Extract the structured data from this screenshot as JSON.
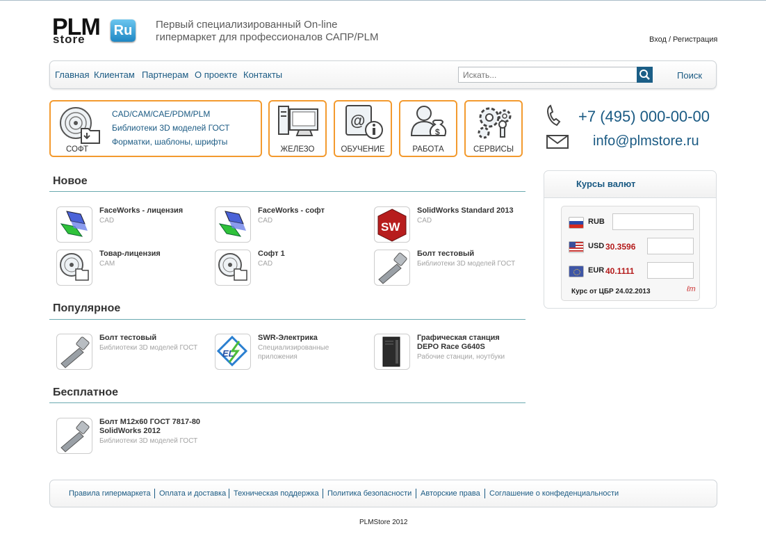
{
  "header": {
    "logo_plm": "PLM",
    "logo_store": "store",
    "logo_ru": "Ru",
    "tagline_line1": "Первый специализированный On-line",
    "tagline_line2": "гипермаркет для профессионалов САПР/PLM",
    "login": "Вход / Регистрация"
  },
  "nav": {
    "items": [
      "Главная",
      "Клиентам",
      "Партнерам",
      "О проекте",
      "Контакты"
    ],
    "search_placeholder": "Искать...",
    "search_label": "Поиск"
  },
  "categories": {
    "soft": "СОФТ",
    "soft_links": [
      "CAD/CAM/CAE/PDM/PLM",
      "Библиотеки 3D моделей ГОСТ",
      "Форматки, шаблоны, шрифты"
    ],
    "hardware": "ЖЕЛЕЗО",
    "training": "ОБУЧЕНИЕ",
    "work": "РАБОТА",
    "services": "СЕРВИСЫ"
  },
  "contacts": {
    "phone": "+7 (495) 000-00-00",
    "email": "info@plmstore.ru"
  },
  "currency": {
    "title": "Курсы валют",
    "rows": [
      {
        "code": "RUB",
        "rate": ""
      },
      {
        "code": "USD",
        "rate": "30.3596"
      },
      {
        "code": "EUR",
        "rate": "40.1111"
      }
    ],
    "note": "Курс от ЦБР 24.02.2013",
    "mark": "ℓm"
  },
  "sections": {
    "new_title": "Новое",
    "new_items": [
      {
        "name": "FaceWorks - лицензия",
        "cat": "CAD",
        "icon": "faceworks-icon"
      },
      {
        "name": "FaceWorks - софт",
        "cat": "CAD",
        "icon": "faceworks-icon"
      },
      {
        "name": "SolidWorks Standard 2013",
        "cat": "CAD",
        "icon": "solidworks-icon"
      },
      {
        "name": "Товар-лицензия",
        "cat": "CAM",
        "icon": "disc-folder-icon"
      },
      {
        "name": "Софт 1",
        "cat": "CAD",
        "icon": "disc-folder-icon"
      },
      {
        "name": "Болт тестовый",
        "cat": "Библиотеки 3D моделей ГОСТ",
        "icon": "bolt-icon"
      }
    ],
    "popular_title": "Популярное",
    "popular_items": [
      {
        "name": "Болт тестовый",
        "cat": "Библиотеки 3D моделей ГОСТ",
        "icon": "bolt-icon"
      },
      {
        "name": "SWR-Электрика",
        "cat": "Специализированные приложения",
        "icon": "swr-icon"
      },
      {
        "name": "Графическая станция DEPO Race G640S",
        "cat": "Рабочие станции, ноутбуки",
        "icon": "workstation-icon"
      }
    ],
    "free_title": "Бесплатное",
    "free_items": [
      {
        "name": "Болт М12х60 ГОСТ 7817-80 SolidWorks 2012",
        "cat": "Библиотеки 3D моделей ГОСТ",
        "icon": "bolt-icon"
      }
    ]
  },
  "footer": {
    "links": [
      "Правила гипермаркета",
      "Оплата и доставка",
      "Техническая поддержка",
      "Политика безопасности",
      "Авторские права",
      "Соглашение о конфеденциальности"
    ],
    "copyright": "PLMStore 2012"
  },
  "colors": {
    "accent_orange": "#f39a2e",
    "link_blue": "#1a5a83",
    "rate_red": "#b41b1b"
  }
}
